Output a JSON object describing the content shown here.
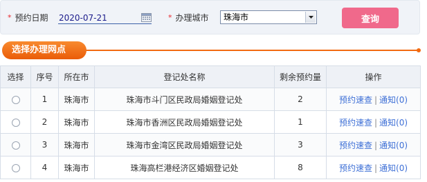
{
  "search": {
    "required_mark": "*",
    "date_label": "预约日期",
    "date_value": "2020-07-21",
    "city_label": "办理城市",
    "city_value": "珠海市",
    "query_label": "查询"
  },
  "section": {
    "title": "选择办理网点"
  },
  "table": {
    "headers": [
      "选择",
      "序号",
      "所在市",
      "登记处名称",
      "剩余预约量",
      "操作"
    ],
    "rows": [
      {
        "index": "1",
        "city": "珠海市",
        "name": "珠海市斗门区民政局婚姻登记处",
        "remaining": "2",
        "action_check": "预约速查",
        "action_notice": "通知(0)"
      },
      {
        "index": "2",
        "city": "珠海市",
        "name": "珠海市香洲区民政局婚姻登记处",
        "remaining": "1",
        "action_check": "预约速查",
        "action_notice": "通知(0)"
      },
      {
        "index": "3",
        "city": "珠海市",
        "name": "珠海市金湾区民政局婚姻登记处",
        "remaining": "3",
        "action_check": "预约速查",
        "action_notice": "通知(0)"
      },
      {
        "index": "4",
        "city": "珠海市",
        "name": "珠海高栏港经济区婚姻登记处",
        "remaining": "8",
        "action_check": "预约速查",
        "action_notice": "通知(0)"
      }
    ],
    "action_separator": "|"
  },
  "icons": {
    "date_picker": "calendar-icon",
    "city_dropdown": "chevron-down-icon",
    "row_select": "radio-button-icon"
  },
  "colors": {
    "required_mark": "#e8272d",
    "query_button": "#f0698b",
    "section_accent": "#f26a10",
    "remaining_count": "#1a7a1a",
    "action_link": "#3d6fd6"
  }
}
